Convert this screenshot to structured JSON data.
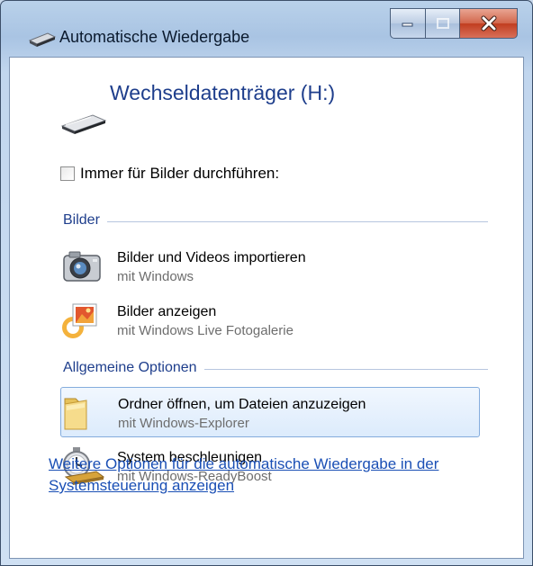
{
  "window": {
    "title": "Automatische Wiedergabe",
    "heading": "Wechseldatenträger (H:)"
  },
  "checkbox": {
    "label": "Immer für Bilder durchführen:",
    "checked": false
  },
  "sections": {
    "bilder": {
      "title": "Bilder",
      "items": [
        {
          "title": "Bilder und Videos importieren",
          "subtitle": "mit Windows",
          "icon": "camera-icon"
        },
        {
          "title": "Bilder anzeigen",
          "subtitle": "mit Windows Live Fotogalerie",
          "icon": "photo-gallery-icon"
        }
      ]
    },
    "allgemein": {
      "title": "Allgemeine Optionen",
      "items": [
        {
          "title": "Ordner öffnen, um Dateien anzuzeigen",
          "subtitle": "mit Windows-Explorer",
          "icon": "folder-icon",
          "selected": true
        },
        {
          "title": "System beschleunigen",
          "subtitle": "mit Windows-ReadyBoost",
          "icon": "stopwatch-icon"
        }
      ]
    }
  },
  "footer": {
    "link": "Weitere Optionen für die automatische Wiedergabe in der Systemsteuerung anzeigen"
  },
  "colors": {
    "heading": "#1e3e8c",
    "link": "#1a4fb5",
    "close_button": "#c13d1f"
  }
}
